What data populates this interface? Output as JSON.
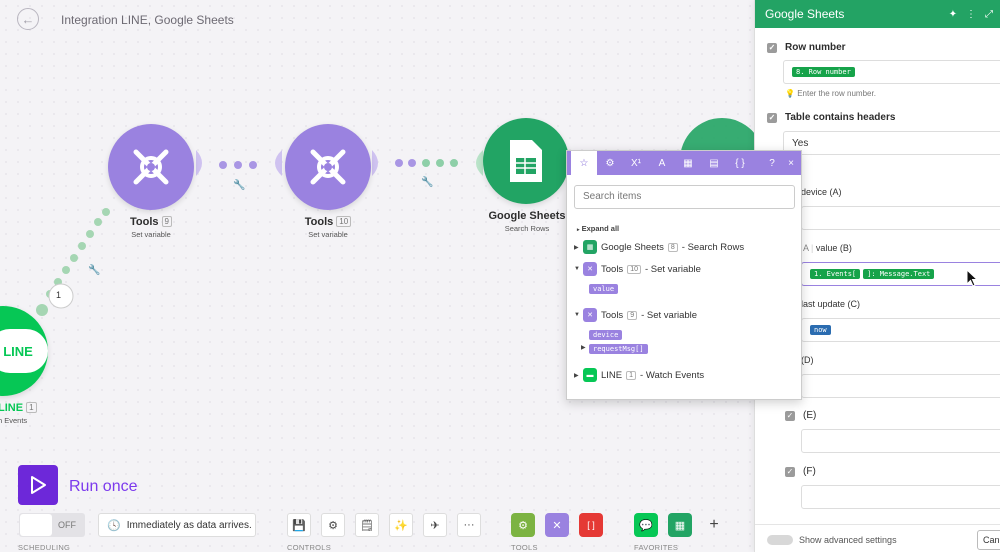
{
  "header": {
    "title": "Integration LINE, Google Sheets",
    "back_icon": "arrow-left-icon"
  },
  "nodes": {
    "tools_a": {
      "name": "Tools",
      "id": "9",
      "subtitle": "Set variable",
      "icon": "tools-icon"
    },
    "tools_b": {
      "name": "Tools",
      "id": "10",
      "subtitle": "Set variable",
      "icon": "tools-icon"
    },
    "sheets": {
      "name": "Google Sheets",
      "subtitle": "Search Rows",
      "icon": "spreadsheet-icon"
    },
    "line": {
      "name": "LINE",
      "id": "1",
      "subtitle": "h Events",
      "icon": "chat-bubble-icon",
      "logo_text": "LINE"
    },
    "route_count": "1"
  },
  "panel": {
    "title": "Google Sheets",
    "row_number": {
      "label": "Row number",
      "pill": "8. Row number",
      "hint": "Enter the row number."
    },
    "table_headers": {
      "label": "Table contains headers",
      "value": "Yes"
    },
    "values_label": "ies",
    "columns": [
      {
        "label": "device (A)",
        "pills": []
      },
      {
        "label": "value (B)",
        "prefix": "A",
        "pills": [
          "1. Events[",
          "]: Message.Text"
        ]
      },
      {
        "label": "last update (C)",
        "pills": [
          "now"
        ]
      },
      {
        "label": "(D)",
        "pills": []
      },
      {
        "label": "(E)",
        "pills": []
      },
      {
        "label": "(F)",
        "pills": []
      }
    ],
    "advanced_label": "Show advanced settings",
    "cancel_label": "Can",
    "colors": {
      "header": "#23a364",
      "pill_green": "#16a34a",
      "pill_blue": "#2b6cb0"
    }
  },
  "popup": {
    "tab_icons": [
      "star-icon",
      "gear-icon",
      "superscript-icon",
      "text-icon",
      "calendar-icon",
      "table-icon",
      "braces-icon"
    ],
    "tab_labels": [
      "☆",
      "⚙",
      "X¹",
      "A",
      "▦",
      "▤",
      "{ }"
    ],
    "help": "?",
    "close": "×",
    "search_placeholder": "Search items",
    "expand_all": "Expand all",
    "tree": [
      {
        "title": "Google Sheets",
        "id": "8",
        "desc": "- Search Rows",
        "items": []
      },
      {
        "title": "Tools",
        "id": "10",
        "desc": "- Set variable",
        "items": [
          "value"
        ]
      },
      {
        "title": "Tools",
        "id": "9",
        "desc": "- Set variable",
        "items": [
          "device",
          "requestMsg[]"
        ]
      },
      {
        "title": "LINE",
        "id": "1",
        "desc": "- Watch Events",
        "items": []
      }
    ]
  },
  "toolbar": {
    "run_label": "Run once",
    "switch_label": "OFF",
    "schedule_text": "Immediately as data arrives.",
    "sections": {
      "scheduling": "SCHEDULING",
      "controls": "CONTROLS",
      "tools": "TOOLS",
      "favorites": "FAVORITES"
    },
    "controls": [
      "save-icon",
      "gear-icon",
      "note-icon",
      "magic-wand-icon",
      "airplane-icon",
      "more-icon"
    ],
    "more_label": "···",
    "add_label": "+",
    "brackets_label": "[ ]"
  },
  "colors": {
    "purple": "#9a82e0",
    "brand": "#6d28d9",
    "line": "#06c755",
    "sheets": "#22a464"
  }
}
